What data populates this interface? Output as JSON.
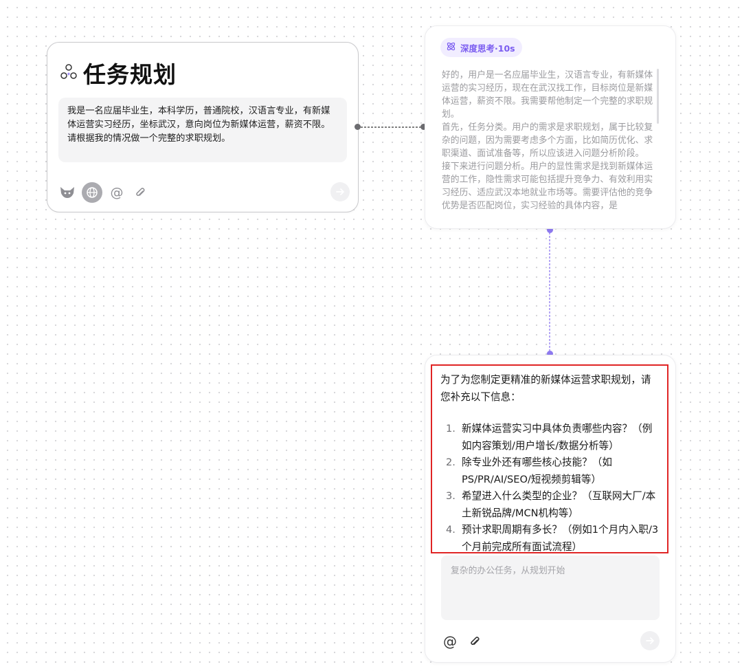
{
  "task_card": {
    "title": "任务规划",
    "prompt": "我是一名应届毕业生，本科学历，普通院校，汉语言专业，有新媒体运营实习经历，坐标武汉，意向岗位为新媒体运营，薪资不限。请根据我的情况做一个完整的求职规划。",
    "tools": {
      "icons": [
        "fox-icon",
        "globe-icon",
        "at-icon",
        "paperclip-icon",
        "send-arrow-icon"
      ],
      "at_symbol": "@"
    }
  },
  "thinking_card": {
    "badge": "深度思考·10s",
    "paragraphs": [
      "好的，用户是一名应届毕业生，汉语言专业，有新媒体运营的实习经历，现在在武汉找工作，目标岗位是新媒体运营，薪资不限。我需要帮他制定一个完整的求职规划。",
      "首先，任务分类。用户的需求是求职规划，属于比较复杂的问题，因为需要考虑多个方面，比如简历优化、求职渠道、面试准备等，所以应该进入问题分析阶段。",
      "接下来进行问题分析。用户的显性需求是找到新媒体运营的工作，隐性需求可能包括提升竞争力、有效利用实习经历、适应武汉本地就业市场等。需要评估他的竞争优势是否匹配岗位，实习经验的具体内容，是"
    ]
  },
  "answer_card": {
    "intro": "为了为您制定更精准的新媒体运营求职规划，请您补充以下信息：",
    "questions": [
      {
        "num": "1.",
        "text": "新媒体运营实习中具体负责哪些内容？（例如内容策划/用户增长/数据分析等）"
      },
      {
        "num": "2.",
        "text": "除专业外还有哪些核心技能？（如PS/PR/AI/SEO/短视频剪辑等）"
      },
      {
        "num": "3.",
        "text": "希望进入什么类型的企业？（互联网大厂/本土新锐品牌/MCN机构等）"
      },
      {
        "num": "4.",
        "text": "预计求职周期有多长？（例如1个月内入职/3个月前完成所有面试流程）"
      }
    ],
    "input_placeholder": "复杂的办公任务，从规划开始",
    "at_symbol": "@"
  },
  "colors": {
    "accent_purple": "#7a5cf0",
    "highlight_red": "#e02424",
    "connector_gray": "#6c6c70"
  }
}
